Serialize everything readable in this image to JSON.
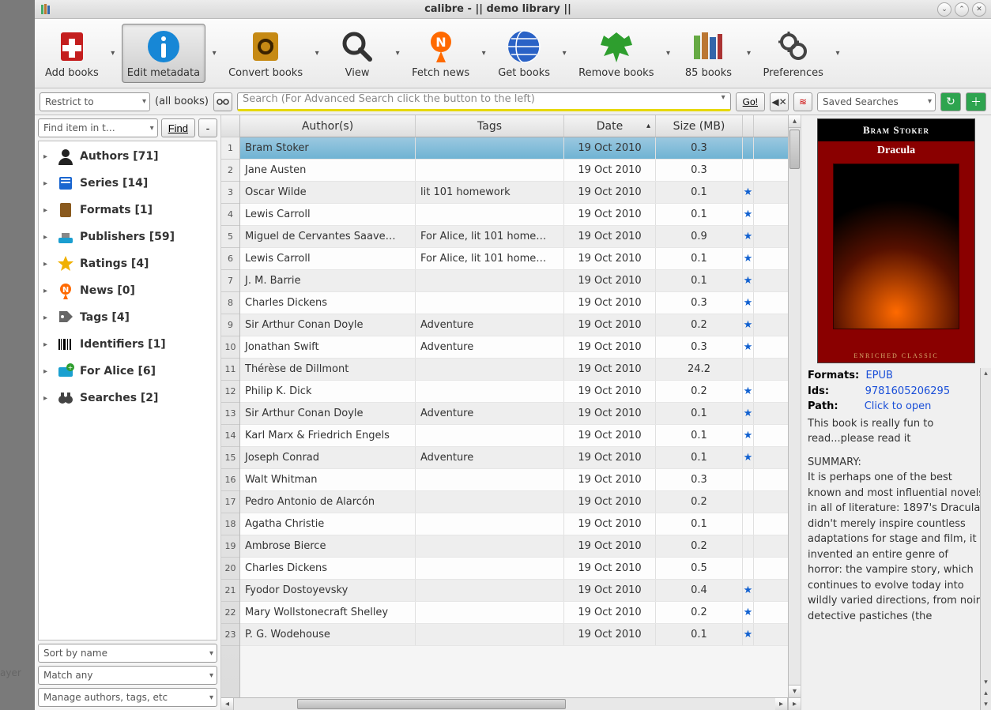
{
  "window": {
    "title": "calibre - || demo library ||"
  },
  "toolbar": [
    {
      "label": "Add books",
      "icon": "add-books",
      "color": "#c41e1e"
    },
    {
      "label": "Edit metadata",
      "icon": "info",
      "color": "#1787d6",
      "pressed": true
    },
    {
      "label": "Convert books",
      "icon": "convert",
      "color": "#c68a14"
    },
    {
      "label": "View",
      "icon": "view",
      "color": "#333"
    },
    {
      "label": "Fetch news",
      "icon": "news",
      "color": "#ff6a00"
    },
    {
      "label": "Get books",
      "icon": "get-books",
      "color": "#2a62c6"
    },
    {
      "label": "Remove books",
      "icon": "remove",
      "color": "#2e9e2e"
    },
    {
      "label": "85 books",
      "icon": "library",
      "color": "#665533"
    },
    {
      "label": "Preferences",
      "icon": "prefs",
      "color": "#444"
    }
  ],
  "search": {
    "restrict_label": "Restrict to",
    "allbooks": "(all books)",
    "placeholder": "Search (For Advanced Search click the button to the left)",
    "go": "Go!",
    "saved": "Saved Searches"
  },
  "sidebar": {
    "finder_placeholder": "Find item in t…",
    "find_label": "Find",
    "minus_label": "-",
    "tree": [
      {
        "label": "Authors [71]",
        "icon": "person",
        "color": "#222"
      },
      {
        "label": "Series [14]",
        "icon": "series",
        "color": "#1a66d0"
      },
      {
        "label": "Formats [1]",
        "icon": "formats",
        "color": "#8a5a1e"
      },
      {
        "label": "Publishers [59]",
        "icon": "publisher",
        "color": "#1a9ed0"
      },
      {
        "label": "Ratings [4]",
        "icon": "star",
        "color": "#f0b000"
      },
      {
        "label": "News [0]",
        "icon": "news",
        "color": "#ff6a00"
      },
      {
        "label": "Tags [4]",
        "icon": "tag",
        "color": "#666"
      },
      {
        "label": "Identifiers [1]",
        "icon": "barcode",
        "color": "#000"
      },
      {
        "label": "For Alice [6]",
        "icon": "folder-add",
        "color": "#1aa0d0"
      },
      {
        "label": "Searches [2]",
        "icon": "binoculars",
        "color": "#444"
      }
    ],
    "sort": "Sort by name",
    "match": "Match any",
    "manage": "Manage authors, tags, etc"
  },
  "columns": {
    "author": "Author(s)",
    "tags": "Tags",
    "date": "Date",
    "size": "Size (MB)"
  },
  "sort_column": "date",
  "sort_dir": "asc",
  "rows": [
    {
      "n": 1,
      "author": "Bram Stoker",
      "tags": "",
      "date": "19 Oct 2010",
      "size": "0.3",
      "star": false,
      "selected": true
    },
    {
      "n": 2,
      "author": "Jane Austen",
      "tags": "",
      "date": "19 Oct 2010",
      "size": "0.3",
      "star": false
    },
    {
      "n": 3,
      "author": "Oscar Wilde",
      "tags": "lit 101 homework",
      "date": "19 Oct 2010",
      "size": "0.1",
      "star": true
    },
    {
      "n": 4,
      "author": "Lewis Carroll",
      "tags": "",
      "date": "19 Oct 2010",
      "size": "0.1",
      "star": true
    },
    {
      "n": 5,
      "author": "Miguel de Cervantes Saave…",
      "tags": "For Alice, lit 101 home…",
      "date": "19 Oct 2010",
      "size": "0.9",
      "star": true
    },
    {
      "n": 6,
      "author": "Lewis Carroll",
      "tags": "For Alice, lit 101 home…",
      "date": "19 Oct 2010",
      "size": "0.1",
      "star": true
    },
    {
      "n": 7,
      "author": "J. M. Barrie",
      "tags": "",
      "date": "19 Oct 2010",
      "size": "0.1",
      "star": true
    },
    {
      "n": 8,
      "author": "Charles Dickens",
      "tags": "",
      "date": "19 Oct 2010",
      "size": "0.3",
      "star": true
    },
    {
      "n": 9,
      "author": "Sir Arthur Conan Doyle",
      "tags": "Adventure",
      "date": "19 Oct 2010",
      "size": "0.2",
      "star": true
    },
    {
      "n": 10,
      "author": "Jonathan Swift",
      "tags": "Adventure",
      "date": "19 Oct 2010",
      "size": "0.3",
      "star": true
    },
    {
      "n": 11,
      "author": "Thérèse de Dillmont",
      "tags": "",
      "date": "19 Oct 2010",
      "size": "24.2",
      "star": false
    },
    {
      "n": 12,
      "author": "Philip K. Dick",
      "tags": "",
      "date": "19 Oct 2010",
      "size": "0.2",
      "star": true
    },
    {
      "n": 13,
      "author": "Sir Arthur Conan Doyle",
      "tags": "Adventure",
      "date": "19 Oct 2010",
      "size": "0.1",
      "star": true
    },
    {
      "n": 14,
      "author": "Karl Marx & Friedrich Engels",
      "tags": "",
      "date": "19 Oct 2010",
      "size": "0.1",
      "star": true
    },
    {
      "n": 15,
      "author": "Joseph Conrad",
      "tags": "Adventure",
      "date": "19 Oct 2010",
      "size": "0.1",
      "star": true
    },
    {
      "n": 16,
      "author": "Walt Whitman",
      "tags": "",
      "date": "19 Oct 2010",
      "size": "0.3",
      "star": false
    },
    {
      "n": 17,
      "author": "Pedro Antonio de Alarcón",
      "tags": "",
      "date": "19 Oct 2010",
      "size": "0.2",
      "star": false
    },
    {
      "n": 18,
      "author": "Agatha Christie",
      "tags": "",
      "date": "19 Oct 2010",
      "size": "0.1",
      "star": false
    },
    {
      "n": 19,
      "author": "Ambrose Bierce",
      "tags": "",
      "date": "19 Oct 2010",
      "size": "0.2",
      "star": false
    },
    {
      "n": 20,
      "author": "Charles Dickens",
      "tags": "",
      "date": "19 Oct 2010",
      "size": "0.5",
      "star": false
    },
    {
      "n": 21,
      "author": "Fyodor Dostoyevsky",
      "tags": "",
      "date": "19 Oct 2010",
      "size": "0.4",
      "star": true
    },
    {
      "n": 22,
      "author": "Mary Wollstonecraft Shelley",
      "tags": "",
      "date": "19 Oct 2010",
      "size": "0.2",
      "star": true
    },
    {
      "n": 23,
      "author": "P. G. Wodehouse",
      "tags": "",
      "date": "19 Oct 2010",
      "size": "0.1",
      "star": true
    }
  ],
  "details": {
    "cover_author": "Bram Stoker",
    "cover_title": "Dracula",
    "cover_footer": "ENRICHED CLASSIC",
    "formats_label": "Formats:",
    "formats_value": "EPUB",
    "ids_label": "Ids:",
    "ids_value": "9781605206295",
    "path_label": "Path:",
    "path_value": "Click to open",
    "note": "This book is really fun to read...please read it",
    "summary_label": "SUMMARY:",
    "summary": "It is perhaps one of the best known and most influential novels in all of literature: 1897's Dracula didn't merely inspire countless adaptations for stage and film, it invented an entire genre of horror: the vampire story, which continues to evolve today into wildly varied directions, from noir detective pastiches (the"
  },
  "partial_left": "ayer"
}
